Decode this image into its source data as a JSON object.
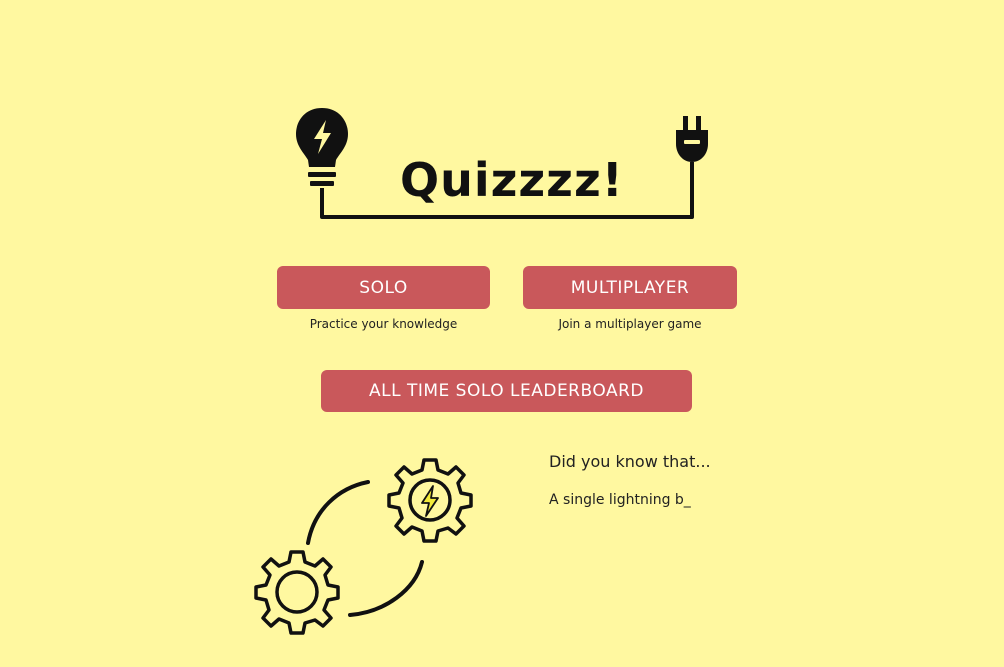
{
  "app": {
    "title": "Quizzzz!"
  },
  "icons": {
    "header_left": "lightbulb-lightning-icon",
    "header_right": "plug-icon",
    "decoration_top": "gear-lightning-icon",
    "decoration_bottom": "gear-icon"
  },
  "menu": {
    "solo_label": "SOLO",
    "solo_caption": "Practice your knowledge",
    "multiplayer_label": "MULTIPLAYER",
    "multiplayer_caption": "Join a multiplayer game",
    "leaderboard_label": "ALL TIME SOLO LEADERBOARD"
  },
  "fact": {
    "heading": "Did you know that...",
    "text": "A single lightning b_"
  },
  "colors": {
    "background": "#fff8a0",
    "button": "#c9585b",
    "button_text": "#ffffff",
    "lightning": "#f2ea3a"
  }
}
